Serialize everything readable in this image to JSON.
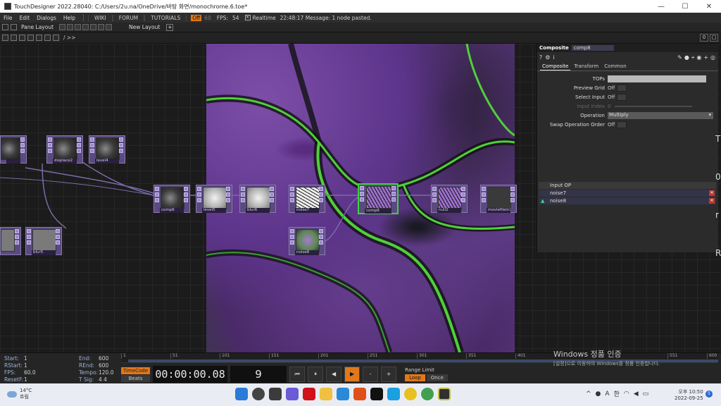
{
  "window": {
    "title": "TouchDesigner 2022.28040: C:/Users/2u.na/OneDrive/바탕 화면/monochrome.6.toe*",
    "minimize": "—",
    "maximize": "☐",
    "close": "✕"
  },
  "menu": {
    "items": [
      "File",
      "Edit",
      "Dialogs",
      "Help"
    ],
    "wiki": "WIKI",
    "forum": "FORUM",
    "tutorials": "TUTORIALS",
    "fps_target": "Off",
    "fps_dim": "60",
    "fps_label": "FPS:",
    "fps_value": "54",
    "realtime_label": "Realtime",
    "message": "22:48:17 Message: 1 node pasted."
  },
  "panebar": {
    "pane_layout": "Pane Layout",
    "new_layout": "New Layout"
  },
  "pathbar": {
    "path": "/ >>",
    "right_a": "0",
    "right_b": "□"
  },
  "nodes": {
    "level_left": "",
    "displace2": "displace2",
    "level4": "level4",
    "comp6": "comp6",
    "level5": "level5",
    "blur6": "blur6",
    "noise7": "noise7",
    "comp8": "comp8",
    "null2": "null2",
    "moviefilein1": "moviefilein1",
    "noise8": "noise8",
    "blur5": "blur5"
  },
  "params": {
    "op_type": "Composite",
    "op_name": "comp8",
    "tabs": [
      "Composite",
      "Transform",
      "Common"
    ],
    "rows": {
      "tops": "TOPs",
      "preview_grid": "Preview Grid",
      "preview_grid_val": "Off",
      "select_input": "Select Input",
      "select_input_val": "Off",
      "input_index": "Input Index",
      "input_index_val": "0",
      "operation": "Operation",
      "operation_val": "Multiply",
      "swap_order": "Swap Operation Order",
      "swap_order_val": "Off"
    },
    "input_header": "Input OP",
    "inputs": [
      "noise7",
      "noise8"
    ]
  },
  "stats": {
    "start_k": "Start:",
    "start_v": "1",
    "end_k": "End:",
    "end_v": "600",
    "rstart_k": "RStart:",
    "rstart_v": "1",
    "rend_k": "REnd:",
    "rend_v": "600",
    "fps_k": "FPS:",
    "fps_v": "60.0",
    "tempo_k": "Tempo:",
    "tempo_v": "120.0",
    "resetf_k": "ResetF:",
    "resetf_v": "1",
    "tsig_k": "T Sig:",
    "tsig_v": "4     4"
  },
  "timeline": {
    "ticks": [
      "1",
      "51",
      "101",
      "151",
      "201",
      "251",
      "301",
      "351",
      "401",
      "551",
      "600"
    ]
  },
  "transport": {
    "timecode": "TimeCode",
    "beats": "Beats",
    "time": "00:00:00.08",
    "frame": "9",
    "btn_start": "⏮",
    "btn_pause": "⏸",
    "btn_back": "◀",
    "btn_play": "▶",
    "btn_minus": "-",
    "btn_plus": "+",
    "range_limit": "Range Limit",
    "loop": "Loop",
    "once": "Once"
  },
  "watermark": {
    "line1": "Windows 정품 인증",
    "line2": "[설정]으로 이동하여 Windows를 정품 인증합니다."
  },
  "taskbar": {
    "temp": "14°C",
    "weather": "흐림",
    "ime_a": "A",
    "ime_han": "한",
    "time": "오후 10:50",
    "date": "2022-09-25",
    "notif": "5"
  },
  "edge_glyphs": [
    "T",
    "U",
    "0",
    "r",
    "R"
  ]
}
